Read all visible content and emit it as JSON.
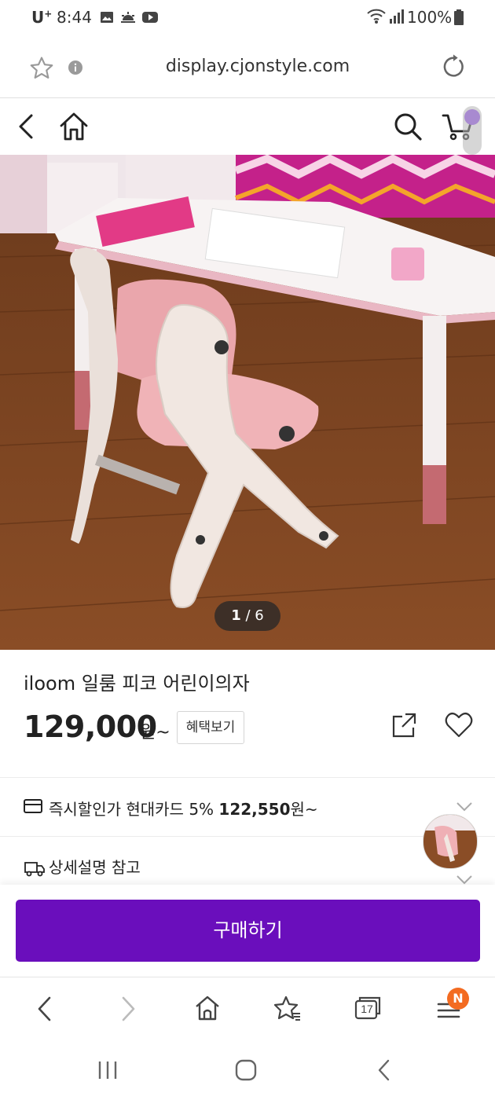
{
  "status_bar": {
    "carrier": "U",
    "carrier_sup": "+",
    "time": "8:44",
    "battery": "100%",
    "icons": [
      "gallery-icon",
      "weather-icon",
      "youtube-icon",
      "wifi-icon",
      "signal-icon",
      "battery-icon"
    ]
  },
  "browser": {
    "url": "display.cjonstyle.com",
    "icons": [
      "star-icon",
      "info-icon",
      "reload-icon"
    ]
  },
  "header": {
    "icons": [
      "back-icon",
      "home-icon",
      "search-icon",
      "cart-icon"
    ]
  },
  "gallery": {
    "current": "1",
    "separator": " / ",
    "total": "6"
  },
  "product": {
    "title": "iloom 일룸 피코 어린이의자",
    "price": "129,000",
    "price_unit": "원~",
    "benefit_label": "혜택보기"
  },
  "discount": {
    "label": "즉시할인가  현대카드 5% ",
    "amount": "122,550",
    "unit": "원~"
  },
  "shipping": {
    "label": "상세설명 참고"
  },
  "buy": {
    "label": "구매하기"
  },
  "bottom_nav": {
    "tabs_count": "17",
    "notification_badge": "N"
  },
  "colors": {
    "brand_purple": "#6a0ebc",
    "badge_orange": "#f36b21"
  }
}
